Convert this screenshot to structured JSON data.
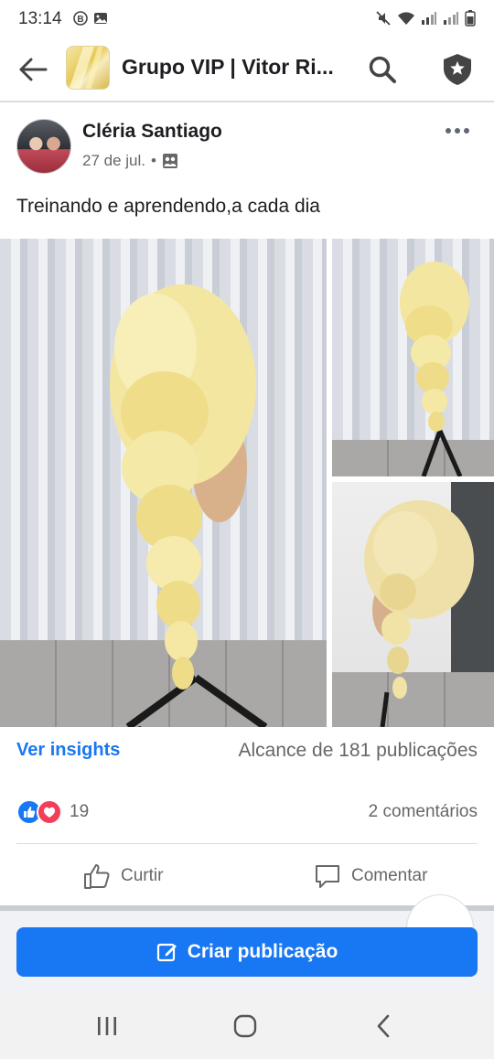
{
  "status_bar": {
    "time": "13:14",
    "icons": [
      "b-circle-icon",
      "gallery-icon",
      "mute-icon",
      "wifi-icon",
      "signal-icon",
      "signal-icon",
      "battery-icon"
    ]
  },
  "header": {
    "group_title": "Grupo VIP | Vitor Ri...",
    "icons": [
      "back-arrow-icon",
      "search-icon",
      "admin-badge-icon"
    ]
  },
  "post": {
    "author": "Cléria Santiago",
    "date": "27 de jul.",
    "separator": "•",
    "privacy_icon": "group-icon",
    "text": "Treinando e aprendendo,a cada dia",
    "photos": [
      "braid-photo-main",
      "braid-photo-top-right",
      "braid-photo-bottom-right"
    ]
  },
  "insights": {
    "link_label": "Ver insights",
    "reach_label": "Alcance de 181 publicações"
  },
  "reactions": {
    "types": [
      "like",
      "love"
    ],
    "count": "19",
    "comments_label": "2 comentários"
  },
  "actions": {
    "like_label": "Curtir",
    "comment_label": "Comentar"
  },
  "create_post": {
    "label": "Criar publicação"
  },
  "colors": {
    "accent": "#1877f2",
    "love": "#f33e58",
    "secondary_text": "#65676b"
  },
  "navbar": {
    "icons": [
      "recent-apps-icon",
      "home-icon",
      "back-icon"
    ]
  }
}
